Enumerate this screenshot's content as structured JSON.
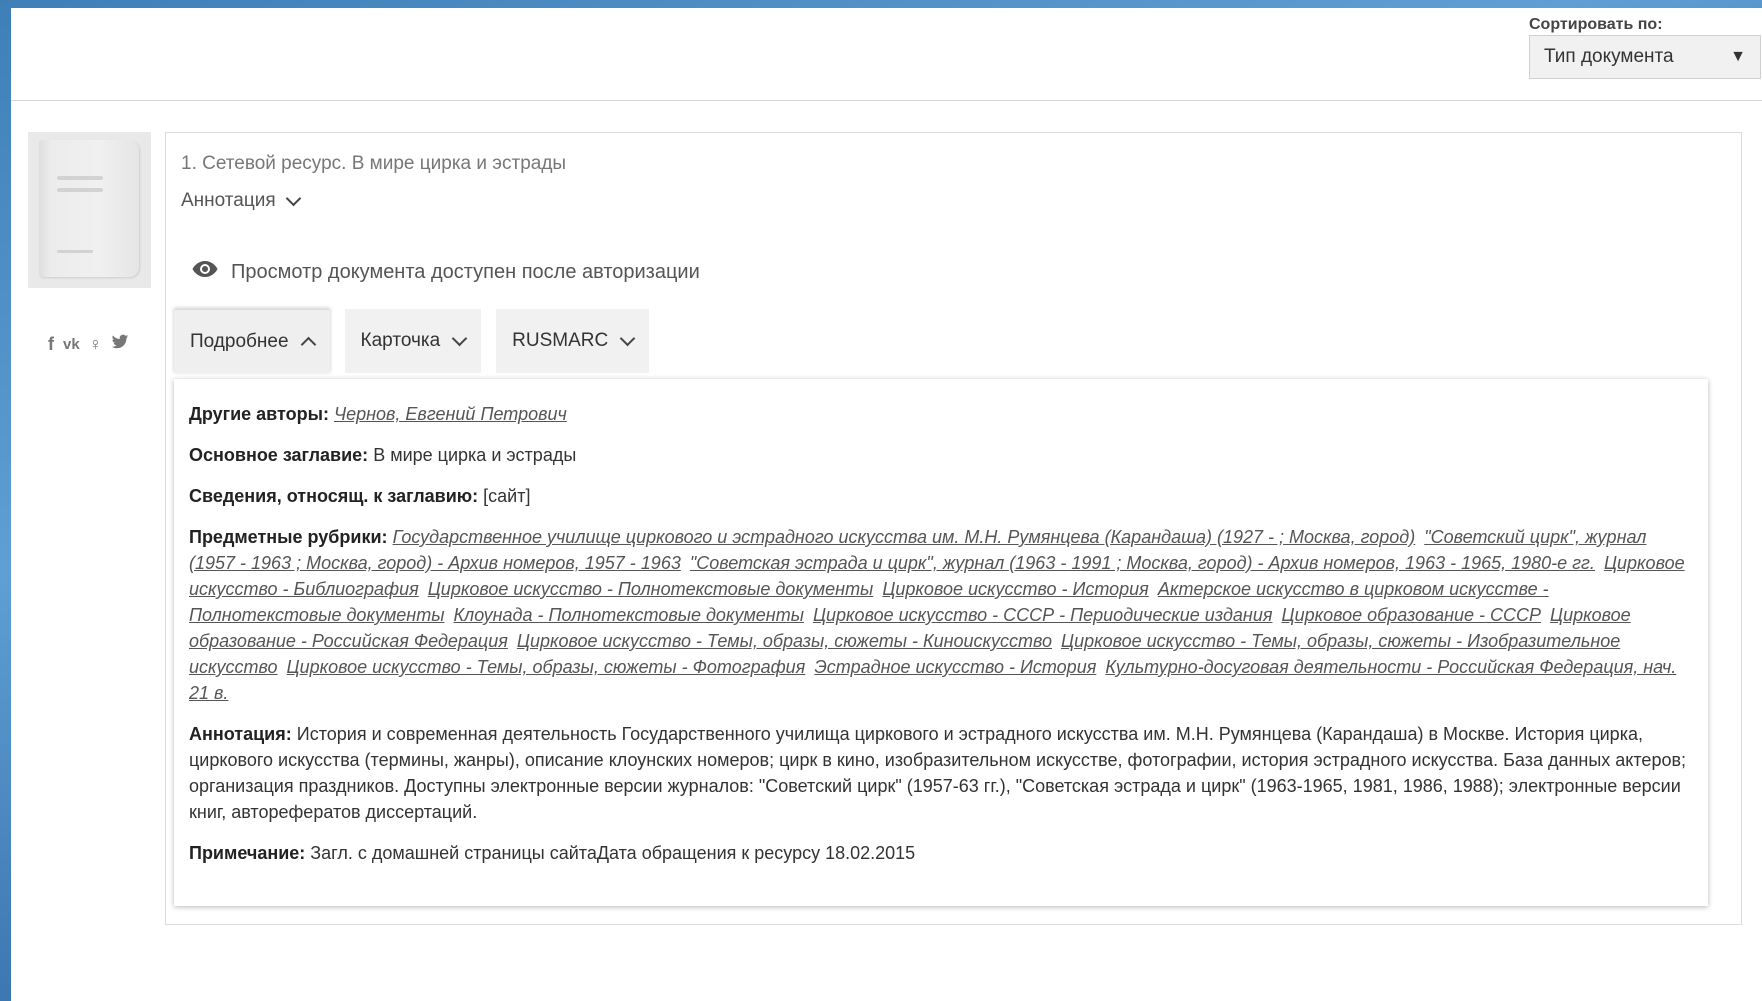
{
  "sort": {
    "label": "Сортировать по:",
    "value": "Тип документа"
  },
  "social": [
    "f",
    "vk",
    "ok",
    "tw"
  ],
  "record": {
    "title": "1. Сетевой ресурс. В мире цирка и эстрады",
    "annotation_toggle": "Аннотация",
    "view_note": "Просмотр документа доступен после авторизации",
    "tabs": [
      "Подробнее",
      "Карточка",
      "RUSMARC"
    ]
  },
  "details": {
    "authors_label": "Другие авторы:",
    "authors_value": "Чернов, Евгений Петрович",
    "main_title_label": "Основное заглавие:",
    "main_title_value": "В мире цирка и эстрады",
    "title_info_label": "Сведения, относящ. к заглавию:",
    "title_info_value": "[сайт]",
    "subjects_label": "Предметные рубрики:",
    "subjects": [
      "Государственное училище циркового и эстрадного искусства им. М.Н. Румянцева (Карандаша) (1927 - ; Москва, город)",
      "\"Советский цирк\", журнал (1957 - 1963 ; Москва, город) - Архив номеров, 1957 - 1963",
      "\"Советская эстрада и цирк\", журнал (1963 - 1991 ; Москва, город) - Архив номеров, 1963 - 1965, 1980-е гг.",
      "Цирковое искусство - Библиография",
      "Цирковое искусство - Полнотекстовые документы",
      "Цирковое искусство - История",
      "Актерское искусство в цирковом искусстве - Полнотекстовые документы",
      "Клоунада - Полнотекстовые документы",
      "Цирковое искусство - СССР - Периодические издания",
      "Цирковое образование - СССР",
      "Цирковое образование - Российская Федерация",
      "Цирковое искусство - Темы, образы, сюжеты - Киноискусство",
      "Цирковое искусство - Темы, образы, сюжеты - Изобразительное искусство",
      "Цирковое искусство - Темы, образы, сюжеты - Фотография",
      "Эстрадное искусство - История",
      "Культурно-досуговая деятельности - Российская Федерация, нач. 21 в."
    ],
    "annotation_label": "Аннотация:",
    "annotation_value": "История и современная деятельность Государственного училища циркового и эстрадного искусства им. М.Н. Румянцева (Карандаша) в Москве. История цирка, циркового искусства (термины, жанры), описание клоунских номеров; цирк в кино, изобразительном искусстве, фотографии, история эстрадного искусства. База данных актеров; организация праздников. Доступны электронные версии журналов: \"Советский цирк\" (1957-63 гг.), \"Советская эстрада и цирк\" (1963-1965, 1981, 1986, 1988); электронные версии книг, авторефератов диссертаций.",
    "note_label": "Примечание:",
    "note_value": "Загл. с домашней страницы сайтаДата обращения к ресурсу 18.02.2015"
  }
}
